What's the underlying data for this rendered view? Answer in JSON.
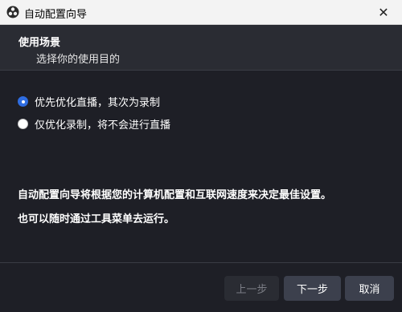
{
  "window": {
    "title": "自动配置向导",
    "app_icon": "obs-logo-icon",
    "close_icon": "close-icon"
  },
  "header": {
    "title": "使用场景",
    "subtitle": "选择你的使用目的"
  },
  "options": [
    {
      "label": "优先优化直播，其次为录制",
      "checked": true
    },
    {
      "label": "仅优化录制，将不会进行直播",
      "checked": false
    }
  ],
  "info": {
    "line1": "自动配置向导将根据您的计算机配置和互联网速度来决定最佳设置。",
    "line2": "也可以随时通过工具菜单去运行。"
  },
  "footer": {
    "back_label": "上一步",
    "next_label": "下一步",
    "cancel_label": "取消"
  },
  "colors": {
    "accent": "#2f6de1",
    "background": "#1e1f26",
    "header": "#2a2c33"
  }
}
